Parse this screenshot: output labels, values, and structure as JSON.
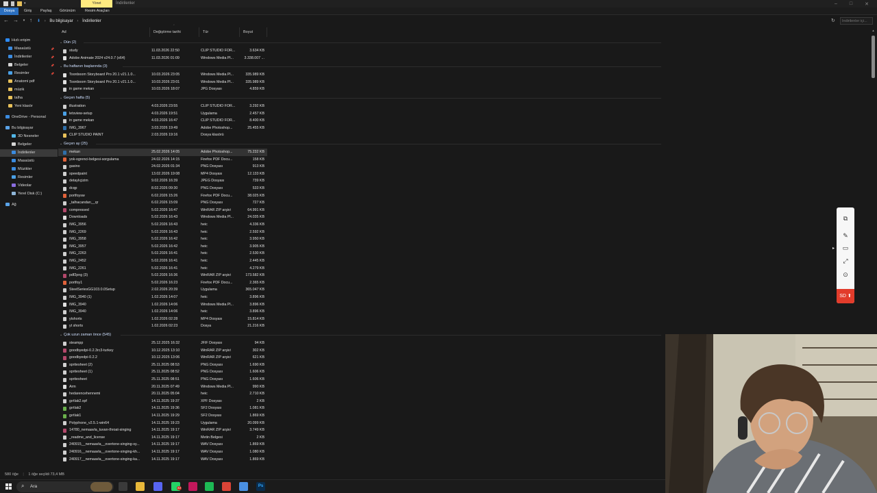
{
  "titlebar": {
    "contextual_tab": "Yönet",
    "title": "İndirilenler"
  },
  "ribbon": {
    "tabs": [
      "Dosya",
      "Giriş",
      "Paylaş",
      "Görünüm",
      "Resim Araçları"
    ]
  },
  "address": {
    "path": [
      "Bu bilgisayar",
      "İndirilenler"
    ],
    "search_placeholder": "İndirilenler içi..."
  },
  "sidebar": {
    "items": [
      {
        "label": "Hızlı erişim",
        "icon": "star-icon",
        "color": "#2d8cff"
      },
      {
        "label": "Masaüstü",
        "icon": "desktop-icon",
        "color": "#3b8be0",
        "pinned": true
      },
      {
        "label": "İndirilenler",
        "icon": "download-icon",
        "color": "#3b8be0",
        "pinned": true
      },
      {
        "label": "Belgeler",
        "icon": "document-icon",
        "color": "#d6d6d6",
        "pinned": true
      },
      {
        "label": "Resimler",
        "icon": "pictures-icon",
        "color": "#4aa0e6",
        "pinned": true
      },
      {
        "label": "Anatomi pdf",
        "icon": "folder-icon",
        "color": "#e8c15a"
      },
      {
        "label": "müzik",
        "icon": "folder-icon",
        "color": "#e8c15a"
      },
      {
        "label": "talha",
        "icon": "folder-icon",
        "color": "#e8c15a"
      },
      {
        "label": "Yeni klasör",
        "icon": "folder-icon",
        "color": "#e8c15a"
      },
      {
        "label": "OneDrive - Personal",
        "icon": "cloud-icon",
        "color": "#3b8be0"
      },
      {
        "label": "Bu bilgisayar",
        "icon": "computer-icon",
        "color": "#5aa3e8"
      },
      {
        "label": "3D Nesneler",
        "icon": "cube-icon",
        "color": "#52b7e8"
      },
      {
        "label": "Belgeler",
        "icon": "document-icon",
        "color": "#d6d6d6"
      },
      {
        "label": "İndirilenler",
        "icon": "download-icon",
        "color": "#3b8be0",
        "selected": true
      },
      {
        "label": "Masaüstü",
        "icon": "desktop-icon",
        "color": "#3b8be0"
      },
      {
        "label": "Müzikler",
        "icon": "music-icon",
        "color": "#3b8be0"
      },
      {
        "label": "Resimler",
        "icon": "pictures-icon",
        "color": "#4aa0e6"
      },
      {
        "label": "Videolar",
        "icon": "video-icon",
        "color": "#8a6de0"
      },
      {
        "label": "Yerel Disk (C:)",
        "icon": "drive-icon",
        "color": "#8fb6d8"
      },
      {
        "label": "Ağ",
        "icon": "network-icon",
        "color": "#5aa3e8"
      }
    ]
  },
  "columns": {
    "name": "Ad",
    "date": "Değiştirme tarihi",
    "type": "Tür",
    "size": "Boyut"
  },
  "groups": [
    {
      "label": "Dün (2)",
      "files": [
        {
          "name": "study",
          "date": "11.03.2026 22:50",
          "type": "CLIP STUDIO FOR...",
          "size": "3.634 KB",
          "icon": "clip-file-icon",
          "color": "#d0d0d0"
        },
        {
          "name": "Adobe Animate 2024 v24.0.7 (x64)",
          "date": "11.03.2026 01:09",
          "type": "Windows Media Pl...",
          "size": "3.338.007 ...",
          "icon": "media-file-icon",
          "color": "#e0e0e0"
        }
      ]
    },
    {
      "label": "Bu haftanın başlarında (3)",
      "files": [
        {
          "name": "Toonboom Storyboard Pro 20.1 v21.1.0...",
          "date": "10.03.2026 23:05",
          "type": "Windows Media Pl...",
          "size": "335.989 KB",
          "icon": "media-file-icon",
          "color": "#e0e0e0"
        },
        {
          "name": "Toonboom Storyboard Pro 20.1 v21.1.0...",
          "date": "10.03.2026 23:01",
          "type": "Windows Media Pl...",
          "size": "335.989 KB",
          "icon": "media-file-icon",
          "color": "#e0e0e0"
        },
        {
          "name": "in game mekan",
          "date": "10.03.2026 18:07",
          "type": "JPG Dosyası",
          "size": "4.859 KB",
          "icon": "image-file-icon",
          "color": "#d0d0d0"
        }
      ]
    },
    {
      "label": "Geçen hafta (5)",
      "files": [
        {
          "name": "illustration",
          "date": "4.03.2026 23:55",
          "type": "CLIP STUDIO FOR...",
          "size": "3.292 KB",
          "icon": "clip-file-icon",
          "color": "#d0d0d0"
        },
        {
          "name": "letsview-setup",
          "date": "4.03.2026 19:51",
          "type": "Uygulama",
          "size": "2.457 KB",
          "icon": "app-file-icon",
          "color": "#4aa0e6"
        },
        {
          "name": "in game mekan",
          "date": "4.03.2026 16:47",
          "type": "CLIP STUDIO FOR...",
          "size": "8.400 KB",
          "icon": "clip-file-icon",
          "color": "#d0d0d0"
        },
        {
          "name": "IMG_3967",
          "date": "3.03.2026 19:49",
          "type": "Adobe Photoshop...",
          "size": "25.455 KB",
          "icon": "photoshop-file-icon",
          "color": "#2f6ea8"
        },
        {
          "name": "CLIP STUDIO PAINT",
          "date": "2.03.2026 19:16",
          "type": "Dosya klasörü",
          "size": "",
          "icon": "folder-icon",
          "color": "#e8c15a"
        }
      ]
    },
    {
      "label": "Geçen ay (25)",
      "files": [
        {
          "name": "mekan",
          "date": "25.02.2026 14:05",
          "type": "Adobe Photoshop...",
          "size": "75.232 KB",
          "icon": "photoshop-file-icon",
          "color": "#2f6ea8",
          "selected": true
        },
        {
          "name": "yok-ogrenci-belgesi-sorgulama",
          "date": "24.02.2026 14:15",
          "type": "Firefox PDF Docu...",
          "size": "158 KB",
          "icon": "pdf-file-icon",
          "color": "#e0623a"
        },
        {
          "name": "gasino",
          "date": "24.02.2026 01:34",
          "type": "PNG Dosyası",
          "size": "913 KB",
          "icon": "image-file-icon",
          "color": "#d0d0d0"
        },
        {
          "name": "speedpaint",
          "date": "13.02.2026 19:08",
          "type": "MP4 Dosyası",
          "size": "12.133 KB",
          "icon": "video-file-icon",
          "color": "#d0d0d0"
        },
        {
          "name": "detaylıçizim",
          "date": "9.02.2026 16:39",
          "type": "JPEG Dosyası",
          "size": "739 KB",
          "icon": "image-file-icon",
          "color": "#d0d0d0"
        },
        {
          "name": "dcqp",
          "date": "8.02.2026 09:30",
          "type": "PNG Dosyası",
          "size": "533 KB",
          "icon": "image-file-icon",
          "color": "#d0d0d0"
        },
        {
          "name": "portfoysw",
          "date": "6.02.2026 15:26",
          "type": "Firefox PDF Docu...",
          "size": "38.025 KB",
          "icon": "pdf-file-icon",
          "color": "#e0623a"
        },
        {
          "name": "_talhacandan__qr",
          "date": "6.02.2026 15:09",
          "type": "PNG Dosyası",
          "size": "727 KB",
          "icon": "image-file-icon",
          "color": "#d0d0d0"
        },
        {
          "name": "compressed",
          "date": "5.02.2026 16:47",
          "type": "WinRAR ZIP arşivi",
          "size": "64.991 KB",
          "icon": "archive-file-icon",
          "color": "#b3486b"
        },
        {
          "name": "Downloads",
          "date": "5.02.2026 16:43",
          "type": "Windows Media Pl...",
          "size": "24.035 KB",
          "icon": "media-file-icon",
          "color": "#e0e0e0"
        },
        {
          "name": "IMG_3956",
          "date": "5.02.2026 16:43",
          "type": "heic",
          "size": "4.336 KB",
          "icon": "image-file-icon",
          "color": "#d0d0d0"
        },
        {
          "name": "IMG_2269",
          "date": "5.02.2026 16:43",
          "type": "heic",
          "size": "2.592 KB",
          "icon": "image-file-icon",
          "color": "#d0d0d0"
        },
        {
          "name": "IMG_3958",
          "date": "5.02.2026 16:42",
          "type": "heic",
          "size": "3.950 KB",
          "icon": "image-file-icon",
          "color": "#d0d0d0"
        },
        {
          "name": "IMG_3957",
          "date": "5.02.2026 16:42",
          "type": "heic",
          "size": "3.905 KB",
          "icon": "image-file-icon",
          "color": "#d0d0d0"
        },
        {
          "name": "IMG_2263",
          "date": "5.02.2026 16:41",
          "type": "heic",
          "size": "2.530 KB",
          "icon": "image-file-icon",
          "color": "#d0d0d0"
        },
        {
          "name": "IMG_2452",
          "date": "5.02.2026 16:41",
          "type": "heic",
          "size": "2.445 KB",
          "icon": "image-file-icon",
          "color": "#d0d0d0"
        },
        {
          "name": "IMG_2261",
          "date": "5.02.2026 16:41",
          "type": "heic",
          "size": "4.279 KB",
          "icon": "image-file-icon",
          "color": "#d0d0d0"
        },
        {
          "name": "pdf2png (3)",
          "date": "5.02.2026 16:36",
          "type": "WinRAR ZIP arşivi",
          "size": "173.582 KB",
          "icon": "archive-file-icon",
          "color": "#b3486b"
        },
        {
          "name": "portfoy1",
          "date": "5.02.2026 16:23",
          "type": "Firefox PDF Docu...",
          "size": "2.365 KB",
          "icon": "pdf-file-icon",
          "color": "#e0623a"
        },
        {
          "name": "SteelSeriesGG103.0.0Setup",
          "date": "2.02.2026 20:39",
          "type": "Uygulama",
          "size": "365.047 KB",
          "icon": "app-file-icon",
          "color": "#cfcfcf"
        },
        {
          "name": "IMG_3940 (1)",
          "date": "1.02.2026 14:07",
          "type": "heic",
          "size": "3.896 KB",
          "icon": "image-file-icon",
          "color": "#d0d0d0"
        },
        {
          "name": "IMG_3940",
          "date": "1.02.2026 14:06",
          "type": "Windows Media Pl...",
          "size": "3.896 KB",
          "icon": "media-file-icon",
          "color": "#e0e0e0"
        },
        {
          "name": "IMG_3940",
          "date": "1.02.2026 14:06",
          "type": "heic",
          "size": "3.896 KB",
          "icon": "image-file-icon",
          "color": "#d0d0d0"
        },
        {
          "name": "ytshorts",
          "date": "1.02.2026 02:28",
          "type": "MP4 Dosyası",
          "size": "15.814 KB",
          "icon": "video-file-icon",
          "color": "#d0d0d0"
        },
        {
          "name": "yt shorts",
          "date": "1.02.2026 02:23",
          "type": "Dosya",
          "size": "21.216 KB",
          "icon": "file-icon",
          "color": "#d0d0d0"
        }
      ]
    },
    {
      "label": "Çok uzun zaman önce (545)",
      "files": [
        {
          "name": "steampp",
          "date": "25.12.2025 16:32",
          "type": "JFIF Dosyası",
          "size": "94 KB",
          "icon": "image-file-icon",
          "color": "#d0d0d0"
        },
        {
          "name": "goodbyedpi-0.2.3rc3-turkey",
          "date": "10.12.2025 13:10",
          "type": "WinRAR ZIP arşivi",
          "size": "302 KB",
          "icon": "archive-file-icon",
          "color": "#b3486b"
        },
        {
          "name": "goodbyedpi-0.2.2",
          "date": "10.12.2025 13:06",
          "type": "WinRAR ZIP arşivi",
          "size": "621 KB",
          "icon": "archive-file-icon",
          "color": "#b3486b"
        },
        {
          "name": "spritesheet (2)",
          "date": "25.11.2025 08:53",
          "type": "PNG Dosyası",
          "size": "1.690 KB",
          "icon": "image-file-icon",
          "color": "#d0d0d0"
        },
        {
          "name": "spritesheet (1)",
          "date": "25.11.2025 08:52",
          "type": "PNG Dosyası",
          "size": "1.606 KB",
          "icon": "image-file-icon",
          "color": "#d0d0d0"
        },
        {
          "name": "spritesheet",
          "date": "25.11.2025 08:51",
          "type": "PNG Dosyası",
          "size": "1.606 KB",
          "icon": "image-file-icon",
          "color": "#d0d0d0"
        },
        {
          "name": "Arm",
          "date": "20.11.2025 07:49",
          "type": "Windows Media Pl...",
          "size": "990 KB",
          "icon": "media-file-icon",
          "color": "#e0e0e0"
        },
        {
          "name": "hedarencehennemi",
          "date": "20.11.2025 05:04",
          "type": "heic",
          "size": "2.710 KB",
          "icon": "image-file-icon",
          "color": "#d0d0d0"
        },
        {
          "name": "gırtlak2.xpf",
          "date": "14.11.2025 19:37",
          "type": "XPF Dosyası",
          "size": "2 KB",
          "icon": "file-icon",
          "color": "#d0d0d0"
        },
        {
          "name": "gırtlak2",
          "date": "14.11.2025 19:36",
          "type": "SF2 Dosyası",
          "size": "1.081 KB",
          "icon": "sound-file-icon",
          "color": "#6ab04c"
        },
        {
          "name": "gırtlak1",
          "date": "14.11.2025 19:29",
          "type": "SF2 Dosyası",
          "size": "1.869 KB",
          "icon": "sound-file-icon",
          "color": "#6ab04c"
        },
        {
          "name": "Polyphone_v2.5.1-win64",
          "date": "14.11.2025 19:23",
          "type": "Uygulama",
          "size": "20.099 KB",
          "icon": "app-file-icon",
          "color": "#cfcfcf"
        },
        {
          "name": "14780_nemaavla_tuvan-throat-singing",
          "date": "14.11.2025 19:17",
          "type": "WinRAR ZIP arşivi",
          "size": "3.749 KB",
          "icon": "archive-file-icon",
          "color": "#b3486b"
        },
        {
          "name": "_readme_and_license",
          "date": "14.11.2025 19:17",
          "type": "Metin Belgesi",
          "size": "2 KB",
          "icon": "text-file-icon",
          "color": "#d0d0d0"
        },
        {
          "name": "240915__nemaavla__overtone-singing-sy...",
          "date": "14.11.2025 19:17",
          "type": "WAV Dosyası",
          "size": "1.869 KB",
          "icon": "audio-file-icon",
          "color": "#d0d0d0"
        },
        {
          "name": "240916__nemaavla__overtone-singing-kh...",
          "date": "14.11.2025 19:17",
          "type": "WAV Dosyası",
          "size": "1.080 KB",
          "icon": "audio-file-icon",
          "color": "#d0d0d0"
        },
        {
          "name": "240917__nemaavla__overtone-singing-ka...",
          "date": "14.11.2025 19:17",
          "type": "WAV Dosyası",
          "size": "1.869 KB",
          "icon": "audio-file-icon",
          "color": "#d0d0d0"
        }
      ]
    }
  ],
  "statusbar": {
    "count": "580 öğe",
    "selection": "1 öğe seçildi  73,4 MB"
  },
  "taskbar": {
    "search_label": "Ara",
    "notification_badge": "42",
    "apps": [
      {
        "icon": "task-view-icon",
        "label": "",
        "color": "#3a3a3a"
      },
      {
        "icon": "file-explorer-icon",
        "label": "",
        "color": "#e8b83a"
      },
      {
        "icon": "discord-icon",
        "label": "",
        "color": "#5865f2"
      },
      {
        "icon": "whatsapp-icon",
        "label": "",
        "color": "#25d366"
      },
      {
        "icon": "app-icon",
        "label": "",
        "color": "#c2185b"
      },
      {
        "icon": "spotify-icon",
        "label": "",
        "color": "#1db954"
      },
      {
        "icon": "chrome-icon",
        "label": "",
        "color": "#db4437"
      },
      {
        "icon": "browser-icon",
        "label": "",
        "color": "#4a90e2"
      },
      {
        "icon": "photoshop-icon",
        "label": "Ps",
        "color": "#0a2c4c"
      }
    ]
  },
  "floating_toolbar": {
    "record_label": "SD"
  },
  "colors": {
    "accent": "#2b6fbf",
    "record": "#e23c2b",
    "context_tab": "#ffeb80"
  }
}
